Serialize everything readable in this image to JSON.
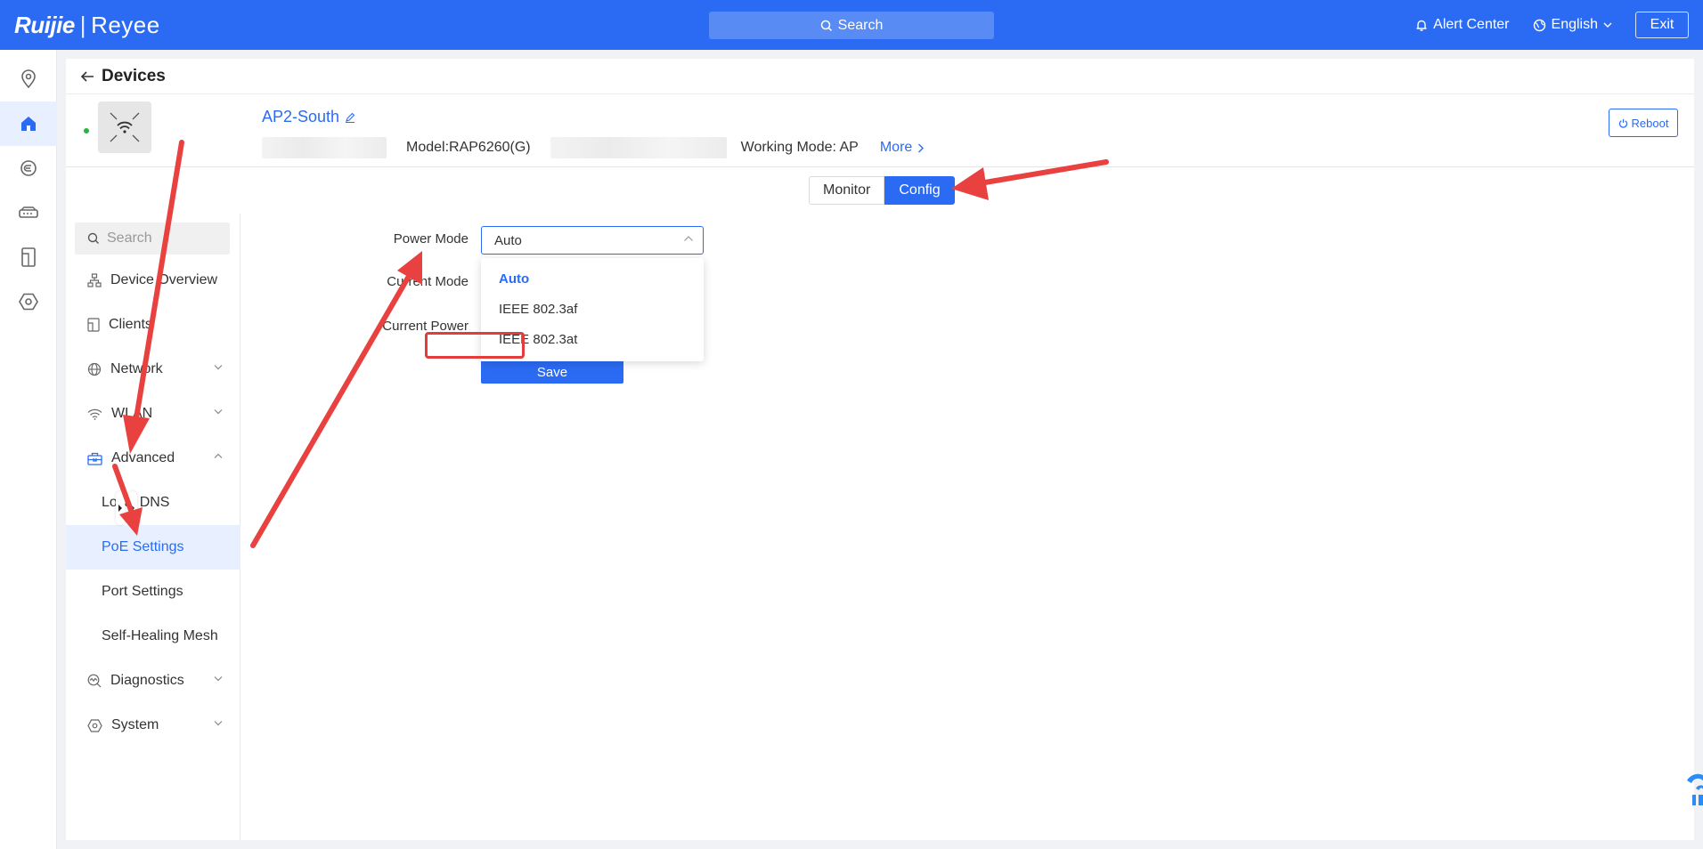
{
  "topbar": {
    "brand_left": "Ruijie",
    "brand_sep": "|",
    "brand_right": "Reyee",
    "search_label": "Search",
    "alert_center": "Alert Center",
    "language": "English",
    "exit": "Exit"
  },
  "rail": {
    "items": [
      "location-icon",
      "home-icon",
      "cloud-icon",
      "switch-icon",
      "device-icon",
      "settings-hex-icon"
    ],
    "active_index": 1
  },
  "page": {
    "title": "Devices"
  },
  "device": {
    "name": "AP2-South",
    "model": "Model:RAP6260(G)",
    "working_mode": "Working Mode: AP",
    "more": "More",
    "reboot": "Reboot",
    "status_color": "#27b440"
  },
  "tabs": [
    "Monitor",
    "Config"
  ],
  "active_tab": "Config",
  "sidebar": {
    "search_placeholder": "Search",
    "items": [
      {
        "label": "Device Overview",
        "icon": "topology-icon"
      },
      {
        "label": "Clients",
        "icon": "client-icon"
      },
      {
        "label": "Network",
        "icon": "globe-icon"
      },
      {
        "label": "WLAN",
        "icon": "wifi-icon"
      },
      {
        "label": "Advanced",
        "icon": "toolbox-icon"
      },
      {
        "label": "Local DNS"
      },
      {
        "label": "PoE Settings"
      },
      {
        "label": "Port Settings"
      },
      {
        "label": "Self-Healing Mesh"
      },
      {
        "label": "Diagnostics",
        "icon": "diagnostics-icon"
      },
      {
        "label": "System",
        "icon": "system-icon"
      }
    ],
    "active_item": "PoE Settings"
  },
  "form": {
    "power_mode_label": "Power Mode",
    "current_mode_label": "Current Mode",
    "current_power_label": "Current Power",
    "power_mode_value": "Auto",
    "options": [
      "Auto",
      "IEEE 802.3af",
      "IEEE 802.3at"
    ],
    "selected_option": "Auto",
    "highlighted_option": "IEEE 802.3at",
    "save": "Save"
  },
  "colors": {
    "brand": "#2b6bf3",
    "annotation": "#e43b3b"
  }
}
